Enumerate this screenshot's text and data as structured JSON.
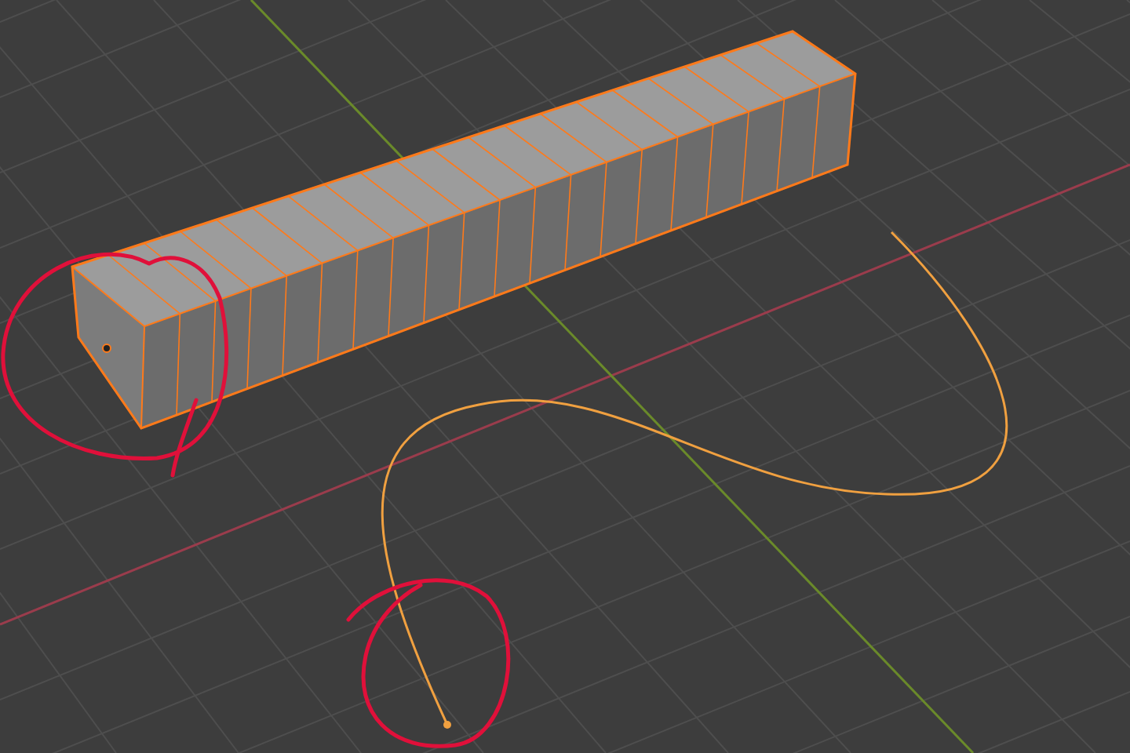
{
  "viewport": {
    "mesh": {
      "selected": true
    },
    "curve": {
      "selected": true
    }
  }
}
